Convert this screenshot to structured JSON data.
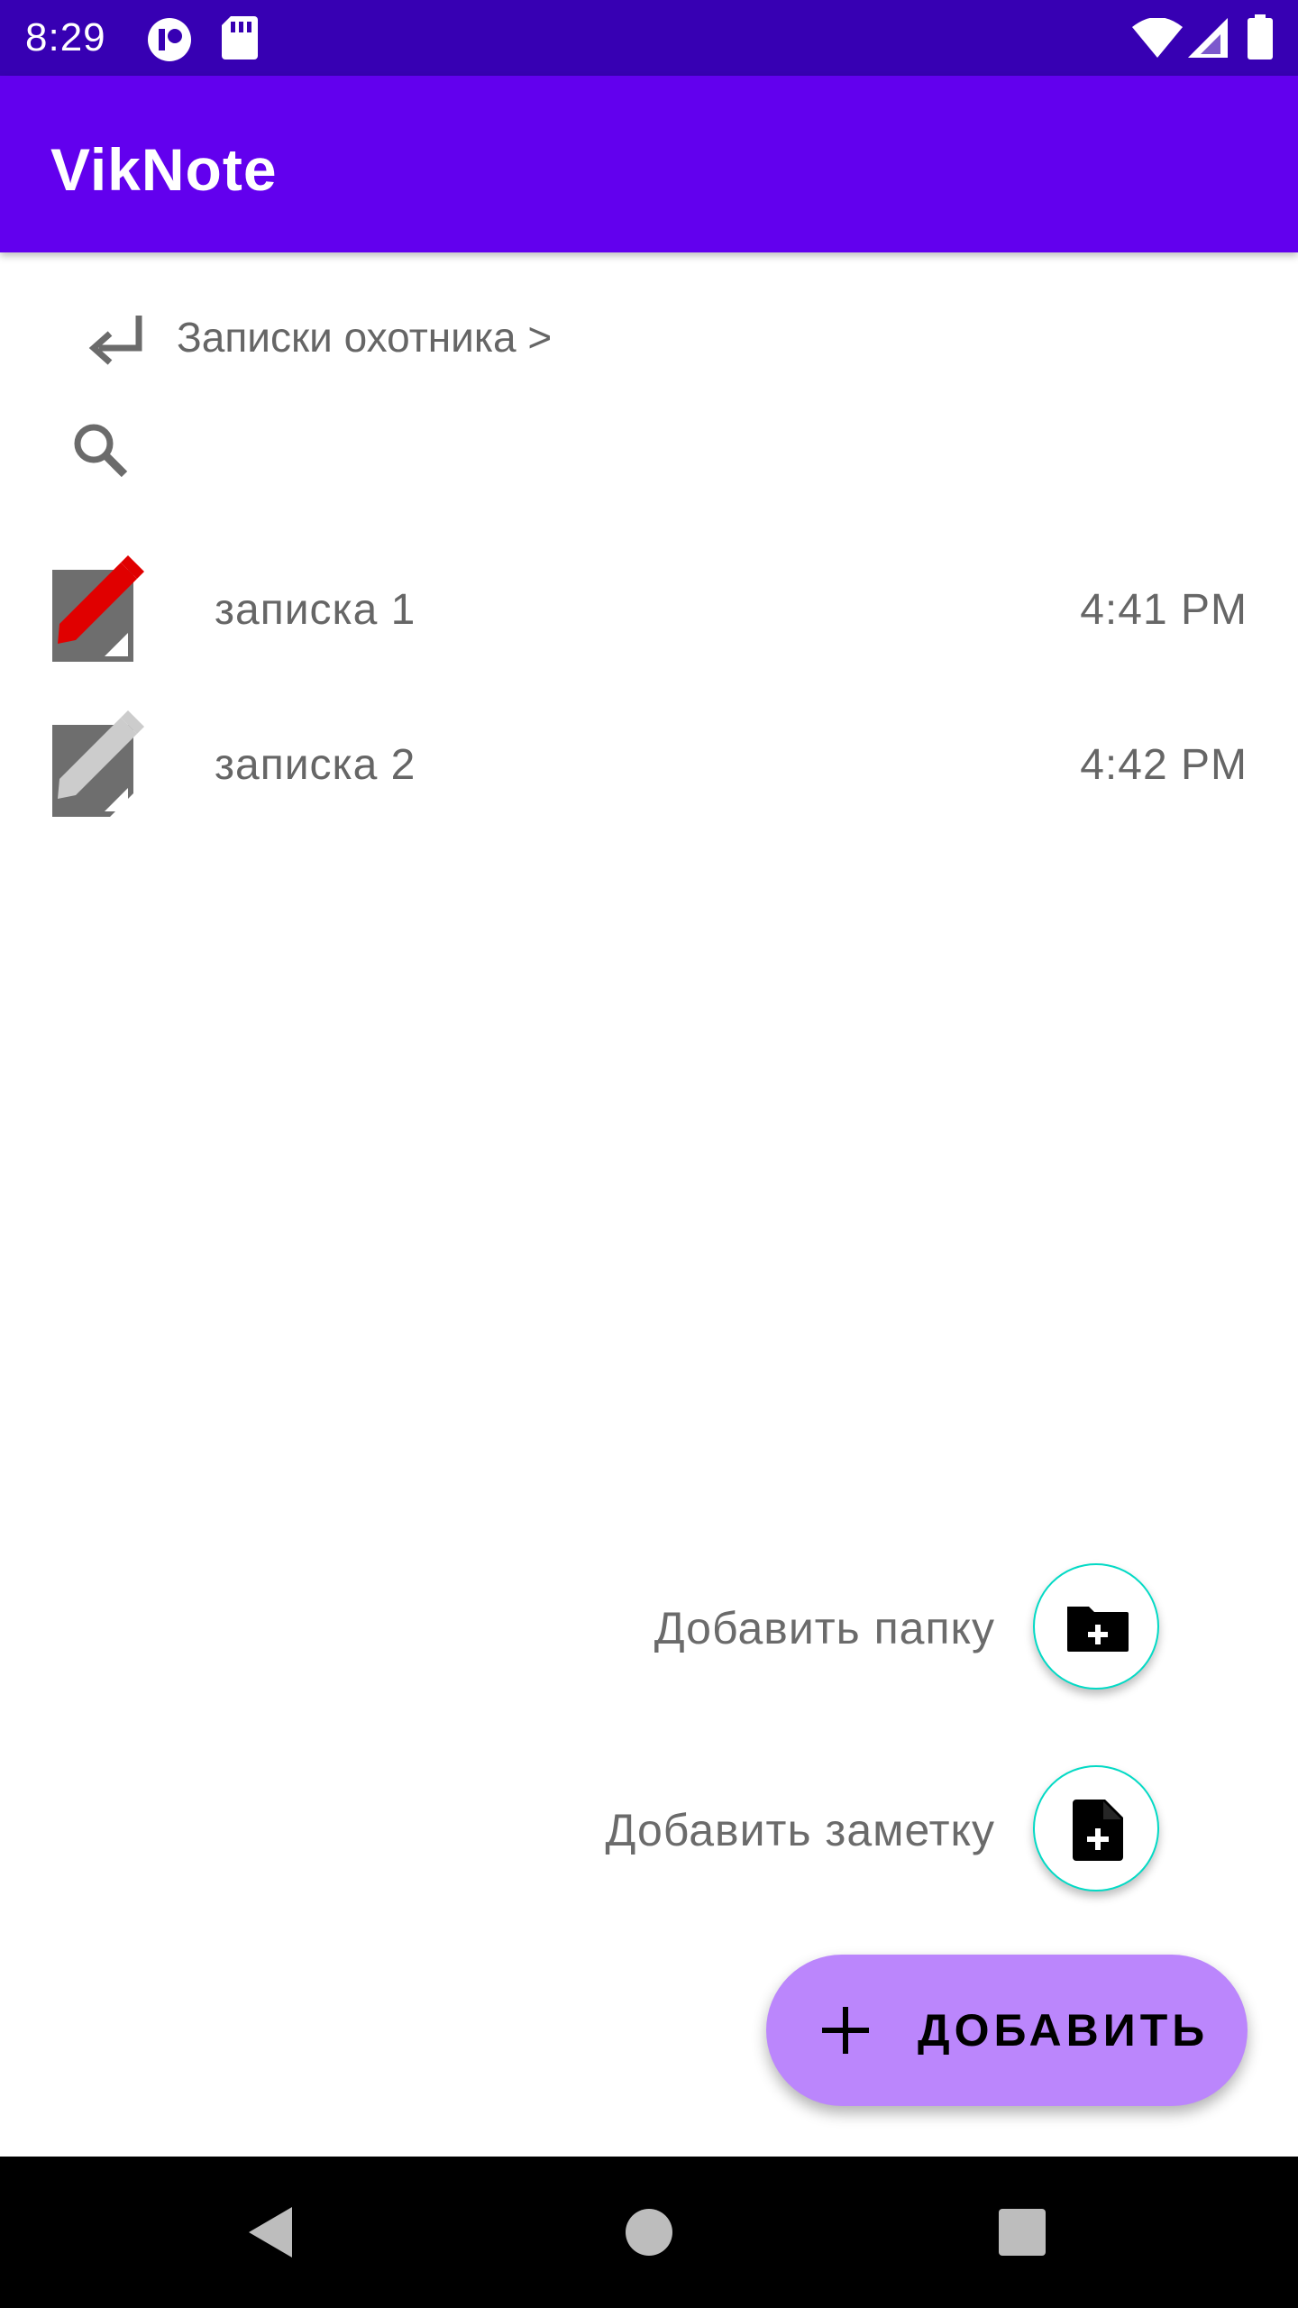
{
  "status_bar": {
    "time": "8:29",
    "icons": [
      "record-icon",
      "sd-card-icon",
      "wifi-icon",
      "signal-icon",
      "battery-icon"
    ],
    "background": "#3700b3"
  },
  "app_bar": {
    "title": "VikNote",
    "background": "#6200ee"
  },
  "breadcrumb": {
    "back_icon": "subdirectory-arrow-left-icon",
    "path": "Записки охотника >"
  },
  "search": {
    "icon": "search-icon"
  },
  "notes": [
    {
      "title": "записка 1",
      "time": "4:41 PM",
      "icon": "note-edit-icon",
      "accent": "#e00000"
    },
    {
      "title": "записка 2",
      "time": "4:42 PM",
      "icon": "note-edit-icon",
      "accent": "#cccccc"
    }
  ],
  "fab_menu": {
    "add_folder_label": "Добавить папку",
    "add_folder_icon": "create-new-folder-icon",
    "add_note_label": "Добавить заметку",
    "add_note_icon": "note-add-icon",
    "main_label": "ДОБАВИТЬ",
    "main_icon": "plus-icon",
    "main_color": "#bb86fc",
    "mini_border_color": "#03dac5"
  },
  "nav_bar": {
    "buttons": [
      "back-triangle-icon",
      "home-circle-icon",
      "recents-square-icon"
    ]
  }
}
